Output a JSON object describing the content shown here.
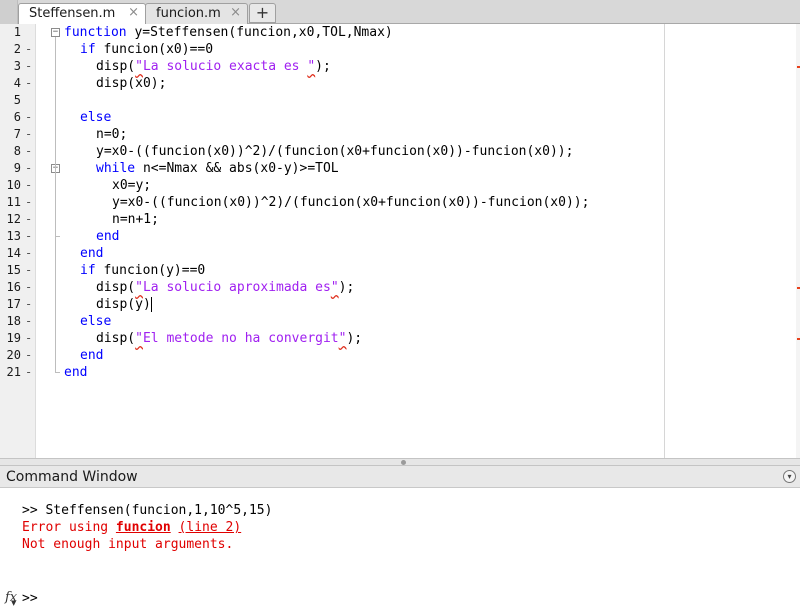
{
  "tabs": [
    {
      "label": "Steffensen.m",
      "close": "×",
      "active": true
    },
    {
      "label": "funcion.m",
      "close": "×",
      "active": false
    }
  ],
  "add_tab_label": "+",
  "editor": {
    "lines": [
      {
        "num": "1",
        "dash": "",
        "fold": "minus",
        "indent": 0,
        "segments": [
          {
            "t": "function",
            "c": "kw"
          },
          {
            "t": " y=Steffensen(funcion,x0,TOL,Nmax)"
          }
        ]
      },
      {
        "num": "2",
        "dash": "-",
        "indent": 1,
        "segments": [
          {
            "t": "if",
            "c": "kw"
          },
          {
            "t": " funcion(x0)==0"
          }
        ]
      },
      {
        "num": "3",
        "dash": "-",
        "indent": 2,
        "segments": [
          {
            "t": "disp("
          },
          {
            "t": "\"",
            "c": "str",
            "sq": true
          },
          {
            "t": "La solucio exacta es ",
            "c": "str"
          },
          {
            "t": "\"",
            "c": "str",
            "sq": true
          },
          {
            "t": ");"
          }
        ]
      },
      {
        "num": "4",
        "dash": "-",
        "indent": 2,
        "segments": [
          {
            "t": "disp(x0);"
          }
        ]
      },
      {
        "num": "5",
        "dash": "",
        "indent": 0,
        "segments": []
      },
      {
        "num": "6",
        "dash": "-",
        "indent": 1,
        "segments": [
          {
            "t": "else",
            "c": "kw"
          }
        ]
      },
      {
        "num": "7",
        "dash": "-",
        "indent": 2,
        "segments": [
          {
            "t": "n=0;"
          }
        ]
      },
      {
        "num": "8",
        "dash": "-",
        "indent": 2,
        "segments": [
          {
            "t": "y=x0-((funcion(x0))^2)/(funcion(x0+funcion(x0))-funcion(x0));"
          }
        ]
      },
      {
        "num": "9",
        "dash": "-",
        "fold": "minus",
        "indent": 2,
        "segments": [
          {
            "t": "while",
            "c": "kw"
          },
          {
            "t": " n<=Nmax && abs(x0-y)>=TOL"
          }
        ]
      },
      {
        "num": "10",
        "dash": "-",
        "indent": 3,
        "segments": [
          {
            "t": "x0=y;"
          }
        ]
      },
      {
        "num": "11",
        "dash": "-",
        "indent": 3,
        "segments": [
          {
            "t": "y=x0-((funcion(x0))^2)/(funcion(x0+funcion(x0))-funcion(x0));"
          }
        ]
      },
      {
        "num": "12",
        "dash": "-",
        "indent": 3,
        "segments": [
          {
            "t": "n=n+1;"
          }
        ]
      },
      {
        "num": "13",
        "dash": "-",
        "indent": 2,
        "segments": [
          {
            "t": "end",
            "c": "kw"
          }
        ]
      },
      {
        "num": "14",
        "dash": "-",
        "indent": 1,
        "segments": [
          {
            "t": "end",
            "c": "kw"
          }
        ]
      },
      {
        "num": "15",
        "dash": "-",
        "indent": 1,
        "segments": [
          {
            "t": "if",
            "c": "kw"
          },
          {
            "t": " funcion(y)==0"
          }
        ]
      },
      {
        "num": "16",
        "dash": "-",
        "indent": 2,
        "segments": [
          {
            "t": "disp("
          },
          {
            "t": "\"",
            "c": "str",
            "sq": true
          },
          {
            "t": "La solucio aproximada es",
            "c": "str"
          },
          {
            "t": "\"",
            "c": "str",
            "sq": true
          },
          {
            "t": ");"
          }
        ]
      },
      {
        "num": "17",
        "dash": "-",
        "indent": 2,
        "segments": [
          {
            "t": "disp(y)"
          }
        ]
      },
      {
        "num": "18",
        "dash": "-",
        "indent": 1,
        "segments": [
          {
            "t": "else",
            "c": "kw"
          }
        ]
      },
      {
        "num": "19",
        "dash": "-",
        "indent": 2,
        "segments": [
          {
            "t": "disp("
          },
          {
            "t": "\"",
            "c": "str",
            "sq": true
          },
          {
            "t": "El metode no ha convergit",
            "c": "str"
          },
          {
            "t": "\"",
            "c": "str",
            "sq": true
          },
          {
            "t": ");"
          }
        ]
      },
      {
        "num": "20",
        "dash": "-",
        "indent": 1,
        "segments": [
          {
            "t": "end",
            "c": "kw"
          }
        ]
      },
      {
        "num": "21",
        "dash": "-",
        "indent": 0,
        "segments": [
          {
            "t": "end",
            "c": "kw"
          }
        ]
      }
    ]
  },
  "command_window": {
    "title": "Command Window",
    "menu_icon": "chevron-down-icon",
    "lines": [
      {
        "segments": [
          {
            "t": ">> Steffensen(funcion,1,10^5,15)",
            "c": "cmd-normal"
          }
        ]
      },
      {
        "segments": [
          {
            "t": "Error using ",
            "c": "cmd-error"
          },
          {
            "t": "funcion",
            "c": "cmd-link"
          },
          {
            "t": " ",
            "c": "cmd-error"
          },
          {
            "t": "(line 2)",
            "c": "cmd-link2"
          }
        ]
      },
      {
        "segments": [
          {
            "t": "Not enough input arguments.",
            "c": "cmd-error"
          }
        ]
      }
    ],
    "prompt": ">>",
    "fx_label": "fx"
  },
  "colors": {
    "keyword": "#0000ff",
    "string": "#a020f0",
    "error": "#e00000",
    "warning_marker": "#e8401c"
  }
}
